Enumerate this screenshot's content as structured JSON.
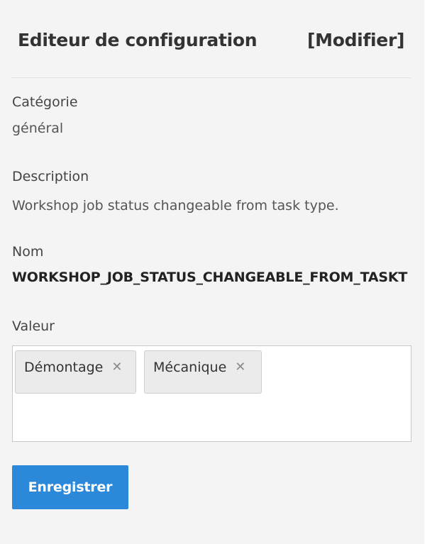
{
  "header": {
    "title": "Editeur de configuration",
    "modify_label": "[Modifier]"
  },
  "fields": {
    "category": {
      "label": "Catégorie",
      "value": "général"
    },
    "description": {
      "label": "Description",
      "value": "Workshop job status changeable from task type."
    },
    "name": {
      "label": "Nom",
      "value": "WORKSHOP_JOB_STATUS_CHANGEABLE_FROM_TASKT"
    },
    "value": {
      "label": "Valeur",
      "tags": [
        {
          "label": "Démontage",
          "remove_icon": "✕"
        },
        {
          "label": "Mécanique",
          "remove_icon": "✕"
        }
      ]
    }
  },
  "actions": {
    "save_label": "Enregistrer"
  },
  "colors": {
    "panel_bg": "#f4f4f5",
    "primary": "#2c88d9",
    "tag_bg": "#ebebec"
  }
}
